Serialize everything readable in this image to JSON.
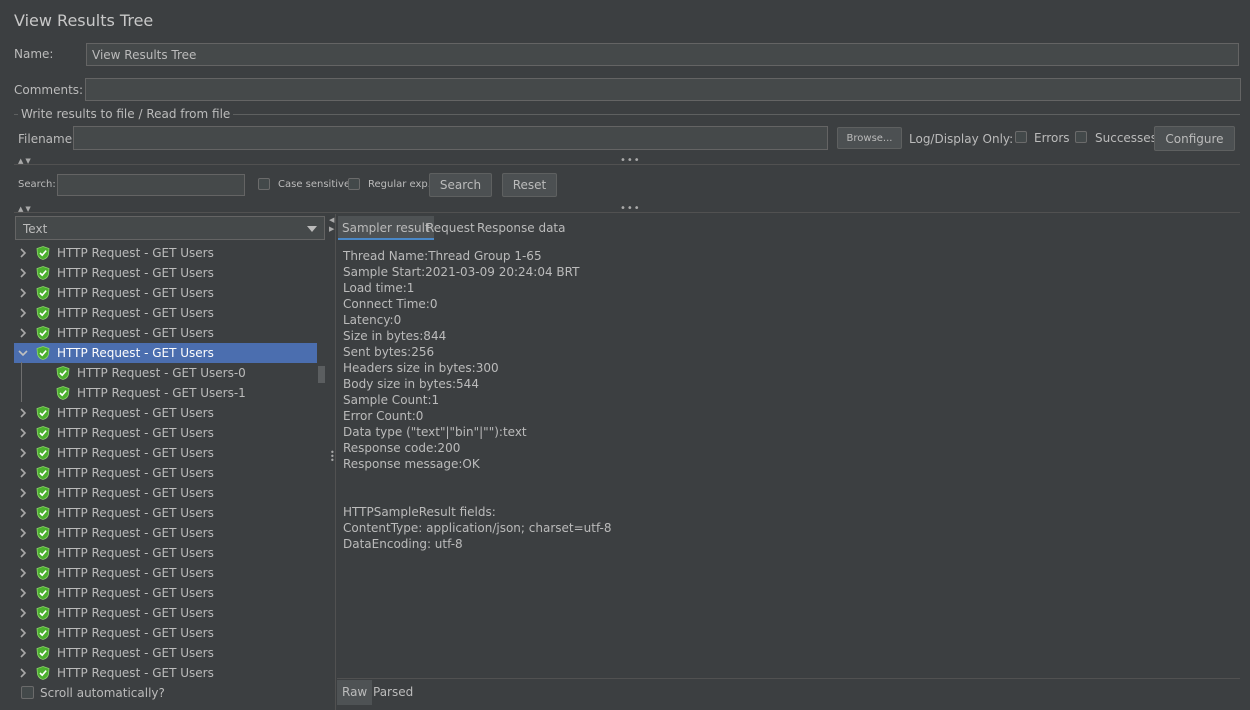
{
  "panel": {
    "title": "View Results Tree"
  },
  "form": {
    "name_label": "Name:",
    "name_value": "View Results Tree",
    "comments_label": "Comments:",
    "comments_value": ""
  },
  "file_section": {
    "legend": "Write results to file / Read from file",
    "filename_label": "Filename",
    "filename_value": "",
    "browse_label": "Browse...",
    "log_display_label": "Log/Display Only:",
    "errors_label": "Errors",
    "errors_checked": false,
    "successes_label": "Successes",
    "successes_checked": false,
    "configure_label": "Configure"
  },
  "search": {
    "label": "Search:",
    "value": "",
    "case_sensitive_label": "Case sensitive",
    "regex_label": "Regular exp.",
    "search_button": "Search",
    "reset_button": "Reset"
  },
  "tree": {
    "renderer_selected": "Text",
    "items": [
      {
        "label": "HTTP Request - GET Users",
        "level": 0,
        "state": "collapsed"
      },
      {
        "label": "HTTP Request - GET Users",
        "level": 0,
        "state": "collapsed"
      },
      {
        "label": "HTTP Request - GET Users",
        "level": 0,
        "state": "collapsed"
      },
      {
        "label": "HTTP Request - GET Users",
        "level": 0,
        "state": "collapsed"
      },
      {
        "label": "HTTP Request - GET Users",
        "level": 0,
        "state": "collapsed"
      },
      {
        "label": "HTTP Request - GET Users",
        "level": 0,
        "state": "expanded",
        "selected": true
      },
      {
        "label": "HTTP Request - GET Users-0",
        "level": 1,
        "state": "leaf"
      },
      {
        "label": "HTTP Request - GET Users-1",
        "level": 1,
        "state": "leaf"
      },
      {
        "label": "HTTP Request - GET Users",
        "level": 0,
        "state": "collapsed"
      },
      {
        "label": "HTTP Request - GET Users",
        "level": 0,
        "state": "collapsed"
      },
      {
        "label": "HTTP Request - GET Users",
        "level": 0,
        "state": "collapsed"
      },
      {
        "label": "HTTP Request - GET Users",
        "level": 0,
        "state": "collapsed"
      },
      {
        "label": "HTTP Request - GET Users",
        "level": 0,
        "state": "collapsed"
      },
      {
        "label": "HTTP Request - GET Users",
        "level": 0,
        "state": "collapsed"
      },
      {
        "label": "HTTP Request - GET Users",
        "level": 0,
        "state": "collapsed"
      },
      {
        "label": "HTTP Request - GET Users",
        "level": 0,
        "state": "collapsed"
      },
      {
        "label": "HTTP Request - GET Users",
        "level": 0,
        "state": "collapsed"
      },
      {
        "label": "HTTP Request - GET Users",
        "level": 0,
        "state": "collapsed"
      },
      {
        "label": "HTTP Request - GET Users",
        "level": 0,
        "state": "collapsed"
      },
      {
        "label": "HTTP Request - GET Users",
        "level": 0,
        "state": "collapsed"
      },
      {
        "label": "HTTP Request - GET Users",
        "level": 0,
        "state": "collapsed"
      },
      {
        "label": "HTTP Request - GET Users",
        "level": 0,
        "state": "collapsed"
      }
    ],
    "scroll_auto_label": "Scroll automatically?",
    "scroll_auto_checked": false
  },
  "result_tabs": [
    "Sampler result",
    "Request",
    "Response data"
  ],
  "result_tab_active": "Sampler result",
  "sampler_result": [
    "Thread Name:Thread Group 1-65",
    "Sample Start:2021-03-09 20:24:04 BRT",
    "Load time:1",
    "Connect Time:0",
    "Latency:0",
    "Size in bytes:844",
    "Sent bytes:256",
    "Headers size in bytes:300",
    "Body size in bytes:544",
    "Sample Count:1",
    "Error Count:0",
    "Data type (\"text\"|\"bin\"|\"\"):text",
    "Response code:200",
    "Response message:OK",
    "",
    "",
    "HTTPSampleResult fields:",
    "ContentType: application/json; charset=utf-8",
    "DataEncoding: utf-8"
  ],
  "bottom_tabs": [
    "Raw",
    "Parsed"
  ],
  "bottom_tab_active": "Raw",
  "colors": {
    "background": "#3c3f41",
    "field": "#45494a",
    "selection": "#4b6eaf",
    "success_shield": "#4caf2f",
    "text": "#bbbbbb"
  },
  "icons": {
    "success": "green-shield-check-icon",
    "expand": "chevron-right-icon",
    "collapse": "chevron-down-icon",
    "dropdown": "triangle-down-icon"
  }
}
